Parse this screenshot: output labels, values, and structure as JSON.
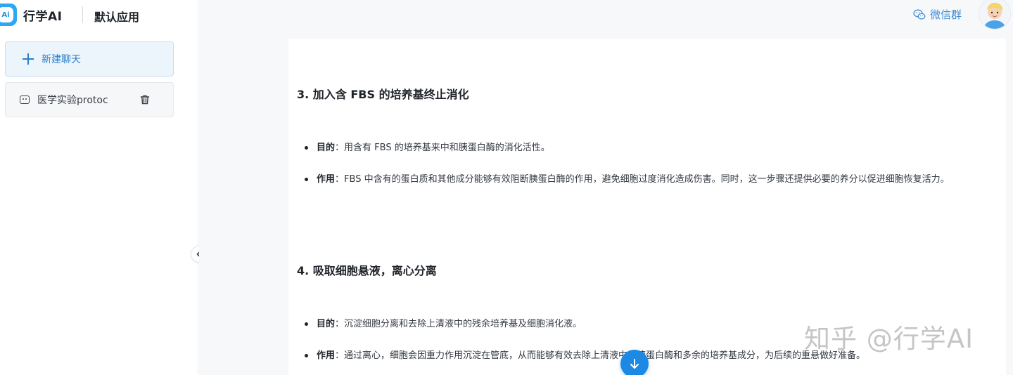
{
  "brand": {
    "logo_text": "Ai",
    "name": "行学AI",
    "app_name": "默认应用"
  },
  "sidebar": {
    "new_chat_label": "新建聊天",
    "history": [
      {
        "label": "医学实验protoc"
      }
    ]
  },
  "topbar": {
    "wechat_label": "微信群"
  },
  "content": {
    "sections": [
      {
        "title": "3. 加入含 FBS 的培养基终止消化",
        "bullets": [
          {
            "term": "目的",
            "sep": "：",
            "text": "用含有 FBS 的培养基来中和胰蛋白酶的消化活性。"
          },
          {
            "term": "作用",
            "sep": "：",
            "text": "FBS 中含有的蛋白质和其他成分能够有效阻断胰蛋白酶的作用，避免细胞过度消化造成伤害。同时，这一步骤还提供必要的养分以促进细胞恢复活力。"
          }
        ]
      },
      {
        "title": "4. 吸取细胞悬液，离心分离",
        "bullets": [
          {
            "term": "目的",
            "sep": "：",
            "text": "沉淀细胞分离和去除上清液中的残余培养基及细胞消化液。"
          },
          {
            "term": "作用",
            "sep": "：",
            "text": "通过离心，细胞会因重力作用沉淀在管底，从而能够有效去除上清液中的胰蛋白酶和多余的培养基成分，为后续的重悬做好准备。"
          }
        ]
      }
    ]
  },
  "watermark": "知乎 @行学AI",
  "colors": {
    "accent": "#1c8ae5",
    "link": "#3d8ed8",
    "new_chat_bg": "#edf5fc"
  },
  "icons": {
    "logo": "logo-icon",
    "new_chat": "plus-icon",
    "history": "bot-icon",
    "delete": "trash-icon",
    "collapse": "chevron-left-icon",
    "wechat": "wechat-icon",
    "scroll_down": "arrow-down-icon"
  }
}
